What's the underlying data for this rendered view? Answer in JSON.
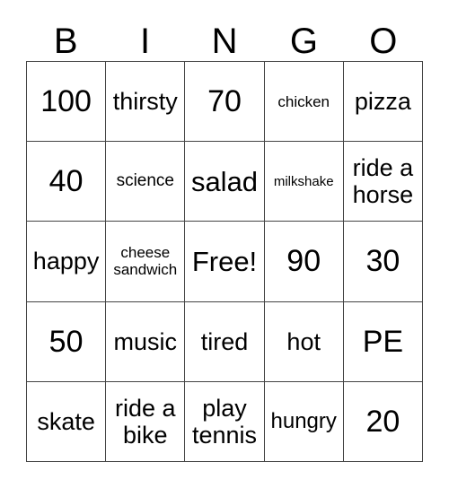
{
  "card": {
    "title": "BINGO",
    "background_color": "#ffffff",
    "text_color": "#000000",
    "border_color": "#444444"
  },
  "header": {
    "letters": [
      {
        "label": "B"
      },
      {
        "label": "I"
      },
      {
        "label": "N"
      },
      {
        "label": "G"
      },
      {
        "label": "O"
      }
    ]
  },
  "grid": {
    "columns": 5,
    "rows": 5,
    "free_space": {
      "row": 2,
      "column": 2,
      "label": "Free!"
    },
    "cells": [
      [
        {
          "label": "100",
          "size": "xl"
        },
        {
          "label": "thirsty",
          "size": "md"
        },
        {
          "label": "70",
          "size": "xl"
        },
        {
          "label": "chicken",
          "size": "xxs"
        },
        {
          "label": "pizza",
          "size": "md"
        }
      ],
      [
        {
          "label": "40",
          "size": "xl"
        },
        {
          "label": "science",
          "size": "xs"
        },
        {
          "label": "salad",
          "size": "lg"
        },
        {
          "label": "milkshake",
          "size": "tiny"
        },
        {
          "label": "ride a horse",
          "size": "md"
        }
      ],
      [
        {
          "label": "happy",
          "size": "md"
        },
        {
          "label": "cheese sandwich",
          "size": "xxs"
        },
        {
          "label": "Free!",
          "size": "lg"
        },
        {
          "label": "90",
          "size": "xl"
        },
        {
          "label": "30",
          "size": "xl"
        }
      ],
      [
        {
          "label": "50",
          "size": "xl"
        },
        {
          "label": "music",
          "size": "md"
        },
        {
          "label": "tired",
          "size": "md"
        },
        {
          "label": "hot",
          "size": "md"
        },
        {
          "label": "PE",
          "size": "xl"
        }
      ],
      [
        {
          "label": "skate",
          "size": "md"
        },
        {
          "label": "ride a bike",
          "size": "md"
        },
        {
          "label": "play tennis",
          "size": "md"
        },
        {
          "label": "hungry",
          "size": "sm"
        },
        {
          "label": "20",
          "size": "xl"
        }
      ]
    ]
  }
}
